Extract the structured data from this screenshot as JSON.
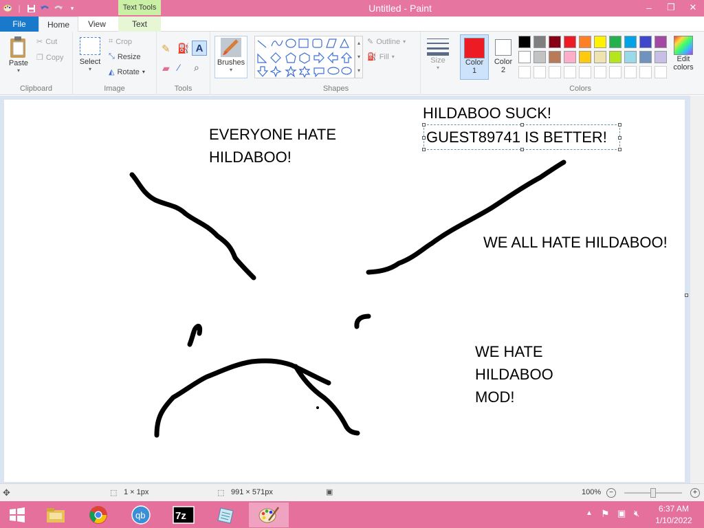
{
  "window": {
    "title": "Untitled - Paint",
    "context_tab_header": "Text Tools"
  },
  "tabs": {
    "file": "File",
    "home": "Home",
    "view": "View",
    "text": "Text"
  },
  "ribbon": {
    "clipboard": {
      "paste": "Paste",
      "cut": "Cut",
      "copy": "Copy",
      "label": "Clipboard"
    },
    "image": {
      "select": "Select",
      "crop": "Crop",
      "resize": "Resize",
      "rotate": "Rotate",
      "label": "Image"
    },
    "tools": {
      "label": "Tools"
    },
    "brushes": "Brushes",
    "shapes": {
      "outline": "Outline",
      "fill": "Fill",
      "label": "Shapes"
    },
    "size": "Size",
    "color1": {
      "line1": "Color",
      "line2": "1"
    },
    "color2": {
      "line1": "Color",
      "line2": "2"
    },
    "edit_colors": {
      "line1": "Edit",
      "line2": "colors"
    },
    "colors_label": "Colors",
    "palette_row1": [
      "#000000",
      "#7f7f7f",
      "#880015",
      "#ed1c24",
      "#ff7f27",
      "#fff200",
      "#22b14c",
      "#00a2e8",
      "#3f48cc",
      "#a349a4"
    ],
    "palette_row2": [
      "#ffffff",
      "#c3c3c3",
      "#b97a57",
      "#ffaec9",
      "#ffc90e",
      "#efe4b0",
      "#b5e61d",
      "#99d9ea",
      "#7092be",
      "#c8bfe7"
    ],
    "color1_value": "#ed1c24",
    "color2_value": "#ffffff"
  },
  "canvas_text": {
    "everyone_line1": "EVERYONE HATE",
    "everyone_line2": "HILDABOO!",
    "suck": "HILDABOO SUCK!",
    "guest": "GUEST89741 IS BETTER!",
    "we_all": "WE ALL HATE HILDABOO!",
    "mod_line1": "WE HATE",
    "mod_line2": "HILDABOO",
    "mod_line3": "MOD!"
  },
  "status": {
    "cursor_pos": "1 × 1px",
    "canvas_size": "991 × 571px",
    "zoom": "100%"
  },
  "taskbar": {
    "time": "6:37 AM",
    "date": "1/10/2022"
  }
}
